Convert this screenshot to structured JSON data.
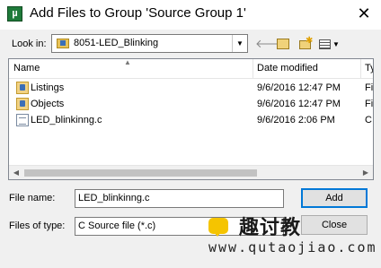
{
  "window": {
    "title": "Add Files to Group 'Source Group 1'",
    "app_icon": "µ"
  },
  "lookin": {
    "label": "Look in:",
    "value": "8051-LED_Blinking"
  },
  "toolbar": {
    "icons": [
      "back-arrow-icon",
      "up-folder-icon",
      "new-folder-icon",
      "view-menu-icon"
    ]
  },
  "list": {
    "columns": [
      "Name",
      "Date modified",
      "Ty"
    ],
    "rows": [
      {
        "name": "Listings",
        "date": "9/6/2016 12:47 PM",
        "type": "Fi",
        "icon": "folder-icon"
      },
      {
        "name": "Objects",
        "date": "9/6/2016 12:47 PM",
        "type": "Fi",
        "icon": "folder-icon"
      },
      {
        "name": "LED_blinkinng.c",
        "date": "9/6/2016 2:06 PM",
        "type": "C",
        "icon": "c-file-icon"
      }
    ]
  },
  "filename": {
    "label": "File name:",
    "value": "LED_blinkinng.c"
  },
  "filetype": {
    "label": "Files of type:",
    "value": "C Source file (*.c)"
  },
  "buttons": {
    "add": "Add",
    "close": "Close"
  },
  "watermark": {
    "text": "趣讨教",
    "url": "www.qutaojiao.com"
  },
  "colors": {
    "accent": "#0078d7",
    "dialog_bg": "#f0f0f0"
  }
}
